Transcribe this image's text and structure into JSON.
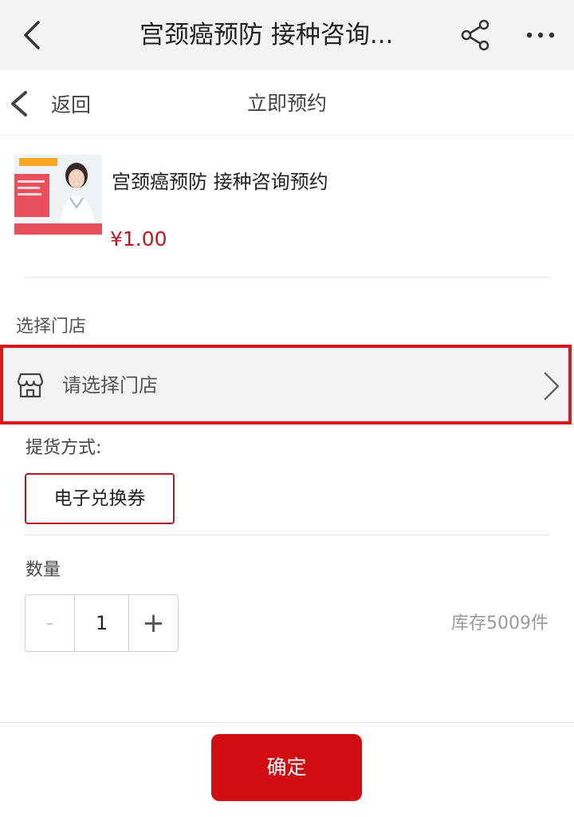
{
  "header": {
    "title": "宫颈癌预防 接种咨询...",
    "icons": [
      "chevron-left-icon",
      "share-icon",
      "more-icon"
    ]
  },
  "nav": {
    "back_label": "返回",
    "title": "立即预约"
  },
  "product": {
    "name": "宫颈癌预防 接种咨询预约",
    "price": "¥1.00"
  },
  "store": {
    "section_label": "选择门店",
    "placeholder": "请选择门店"
  },
  "delivery": {
    "label": "提货方式:",
    "option": "电子兑换券"
  },
  "quantity": {
    "label": "数量",
    "minus": "-",
    "value": "1",
    "plus": "+",
    "stock": "库存5009件"
  },
  "footer": {
    "confirm_label": "确定"
  },
  "colors": {
    "accent": "#cf0d12",
    "highlight_border": "#d9161b",
    "price": "#c8141e"
  }
}
